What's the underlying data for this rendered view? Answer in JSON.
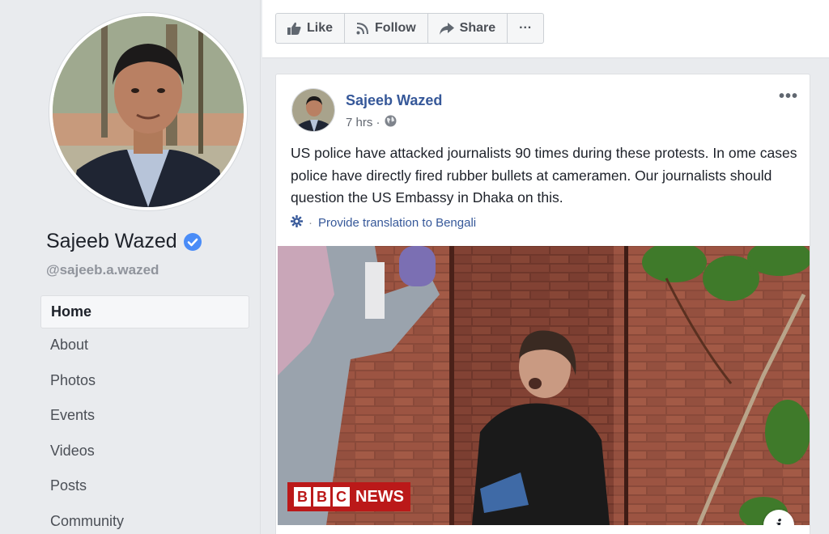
{
  "profile": {
    "name": "Sajeeb Wazed",
    "handle": "@sajeeb.a.wazed",
    "verified": true
  },
  "nav": {
    "items": [
      {
        "label": "Home",
        "active": true
      },
      {
        "label": "About"
      },
      {
        "label": "Photos"
      },
      {
        "label": "Events"
      },
      {
        "label": "Videos"
      },
      {
        "label": "Posts"
      },
      {
        "label": "Community"
      }
    ]
  },
  "actions": {
    "like": "Like",
    "follow": "Follow",
    "share": "Share",
    "more": "···"
  },
  "post": {
    "author": "Sajeeb Wazed",
    "time": "7 hrs ·",
    "privacy_icon": "globe-icon",
    "more": "•••",
    "text": "US police have attacked journalists 90 times during these protests. In ome cases police have directly fired rubber bullets at cameramen. Our journalists should question the US Embassy in Dhaka on this.",
    "translate_sep": "·",
    "translate_label": "Provide translation to Bengali",
    "image": {
      "watermark_letters": [
        "B",
        "B",
        "C"
      ],
      "watermark_word": "NEWS",
      "info": "i"
    }
  },
  "colors": {
    "link": "#365899",
    "verified": "#4a8cf7",
    "bbc_red": "#bb1919",
    "page_bg": "#e9ebee"
  }
}
